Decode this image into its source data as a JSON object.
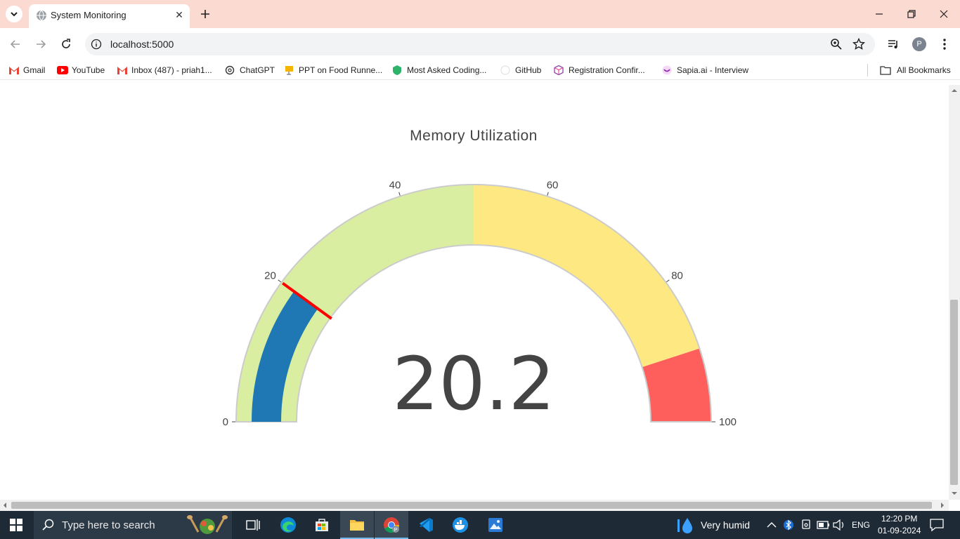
{
  "browser": {
    "tab_title": "System Monitoring",
    "url": "localhost:5000",
    "profile_initial": "P",
    "bookmarks": [
      {
        "label": "Gmail"
      },
      {
        "label": "YouTube"
      },
      {
        "label": "Inbox (487) - priah1..."
      },
      {
        "label": "ChatGPT"
      },
      {
        "label": "PPT on Food Runne..."
      },
      {
        "label": "Most Asked Coding..."
      },
      {
        "label": "GitHub"
      },
      {
        "label": "Registration Confir..."
      },
      {
        "label": "Sapia.ai - Interview"
      }
    ],
    "all_bookmarks": "All Bookmarks"
  },
  "gauge": {
    "title": "Memory Utilization",
    "value": 20.2,
    "value_text": "20.2",
    "min": 0,
    "max": 100,
    "threshold": 20,
    "ticks": [
      "0",
      "20",
      "40",
      "60",
      "80",
      "100"
    ],
    "tick_values": [
      0,
      20,
      40,
      60,
      80,
      100
    ],
    "steps": [
      {
        "from": 0,
        "to": 50,
        "color": "#d9eea0"
      },
      {
        "from": 50,
        "to": 90,
        "color": "#fee881"
      },
      {
        "from": 90,
        "to": 100,
        "color": "#fe5e5c"
      }
    ],
    "bar_color": "#1f77b4",
    "threshold_color": "#ff0000"
  },
  "taskbar": {
    "search_placeholder": "Type here to search",
    "weather": "Very humid",
    "language": "ENG",
    "time": "12:20 PM",
    "date": "01-09-2024"
  }
}
